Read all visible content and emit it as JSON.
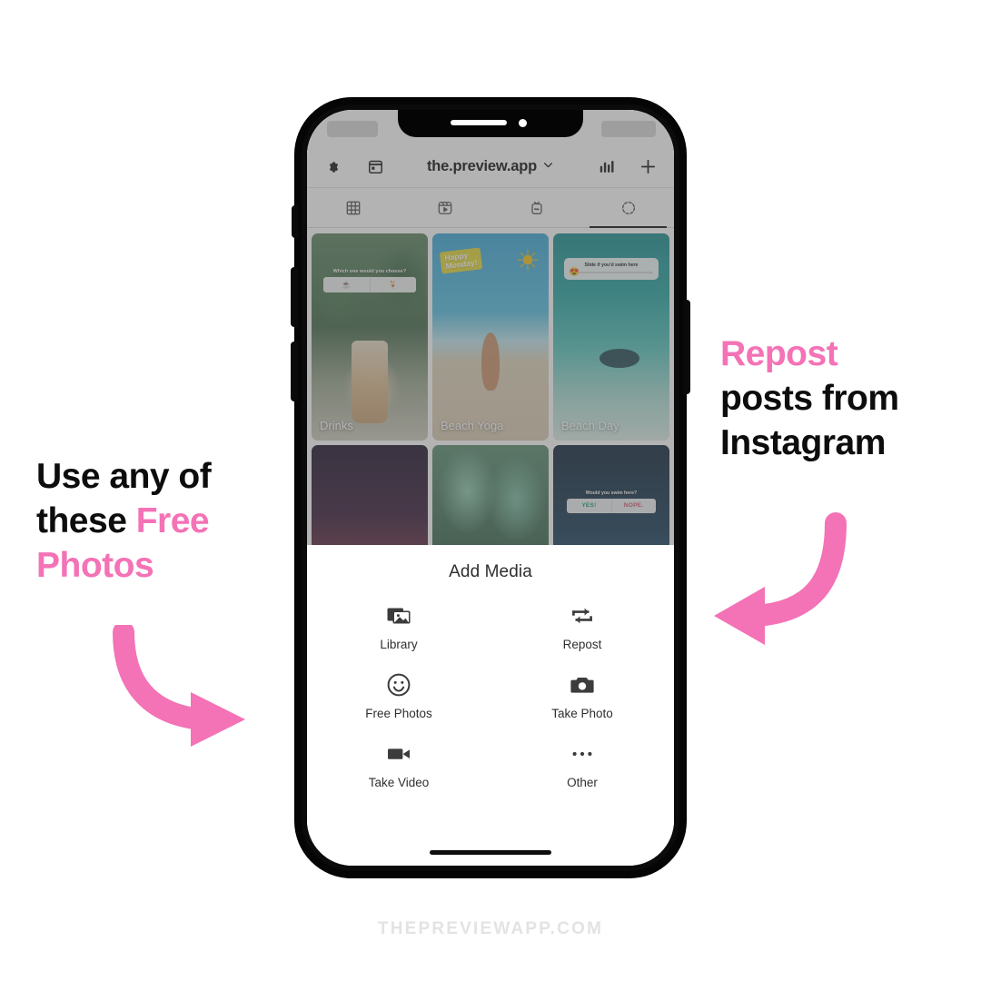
{
  "watermark": "THEPREVIEWAPP.COM",
  "annotations": {
    "left": {
      "line1": "Use any of",
      "line2_plain": "these ",
      "line2_accent": "Free",
      "line3_accent": "Photos",
      "arrow_icon": "curved-arrow-down-right-icon"
    },
    "right": {
      "line1_accent": "Repost",
      "line2": "posts from",
      "line3": "Instagram",
      "arrow_icon": "curved-arrow-down-left-icon"
    },
    "accent_color": "#f472b6"
  },
  "phone": {
    "notch_speaker": "notch-speaker",
    "notch_camera": "notch-camera",
    "buttons": [
      "silent-switch",
      "volume-up",
      "volume-down",
      "power"
    ]
  },
  "app": {
    "nav": {
      "settings_icon": "gear-icon",
      "planner_icon": "calendar-icon",
      "title": "the.preview.app",
      "chevron_icon": "chevron-down-icon",
      "analytics_icon": "bar-chart-icon",
      "add_icon": "plus-icon"
    },
    "tabs": [
      {
        "name": "grid",
        "icon": "grid-icon",
        "active": false
      },
      {
        "name": "reels",
        "icon": "reels-icon",
        "active": false
      },
      {
        "name": "igtv",
        "icon": "igtv-icon",
        "active": false
      },
      {
        "name": "stories",
        "icon": "dashed-circle-icon",
        "active": true
      }
    ],
    "grid": [
      {
        "label": "Drinks",
        "theme": "ph-drinks",
        "sticker": "poll",
        "sticker_question": "Which one would you choose?",
        "sticker_option_a": "☕",
        "sticker_option_b": "🍹"
      },
      {
        "label": "Beach Yoga",
        "theme": "ph-yoga",
        "sticker": "happy",
        "sticker_line1": "Happy",
        "sticker_line2": "Monday!",
        "sun_icon": "sun-icon"
      },
      {
        "label": "Beach Day",
        "theme": "ph-beachday",
        "sticker": "slider",
        "sticker_question": "Slide if you'd swim here",
        "sticker_emoji": "😍"
      },
      {
        "label": "",
        "theme": "ph-night",
        "sticker": "none"
      },
      {
        "label": "",
        "theme": "ph-plants",
        "sticker": "none"
      },
      {
        "label": "",
        "theme": "ph-swim",
        "sticker": "yesno",
        "sticker_question": "Would you swim here?",
        "sticker_yes": "YES!",
        "sticker_no": "NOPE."
      }
    ],
    "sheet": {
      "title": "Add Media",
      "items": [
        {
          "label": "Library",
          "icon": "photo-library-icon"
        },
        {
          "label": "Repost",
          "icon": "repost-icon"
        },
        {
          "label": "Free Photos",
          "icon": "smiley-face-icon"
        },
        {
          "label": "Take Photo",
          "icon": "camera-icon"
        },
        {
          "label": "Take Video",
          "icon": "video-camera-icon"
        },
        {
          "label": "Other",
          "icon": "ellipsis-icon"
        }
      ]
    }
  }
}
